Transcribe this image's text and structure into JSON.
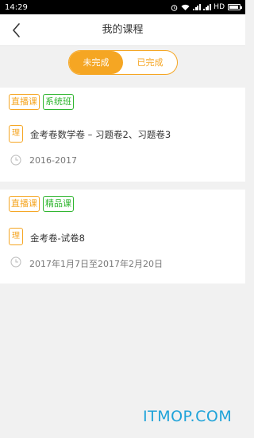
{
  "status_bar": {
    "time": "14:29",
    "network": "HD"
  },
  "header": {
    "title": "我的课程"
  },
  "tabs": [
    {
      "label": "未完成"
    },
    {
      "label": "已完成"
    }
  ],
  "courses": [
    {
      "tags": [
        "直播课",
        "系统班"
      ],
      "subject": "理",
      "title": "金考卷数学卷 – 习题卷2、习题卷3",
      "date": "2016-2017"
    },
    {
      "tags": [
        "直播课",
        "精品课"
      ],
      "subject": "理",
      "title": "金考卷-试卷8",
      "date": "2017年1月7日至2017年2月20日"
    }
  ],
  "watermark": "ITMOP.COM",
  "colors": {
    "accent": "#f5a623",
    "green_tag": "#2fb52f",
    "watermark": "#1fa3d9"
  },
  "icons": [
    "back-arrow-icon",
    "clock-icon",
    "alarm-icon",
    "wifi-icon",
    "signal-icon",
    "battery-icon"
  ]
}
